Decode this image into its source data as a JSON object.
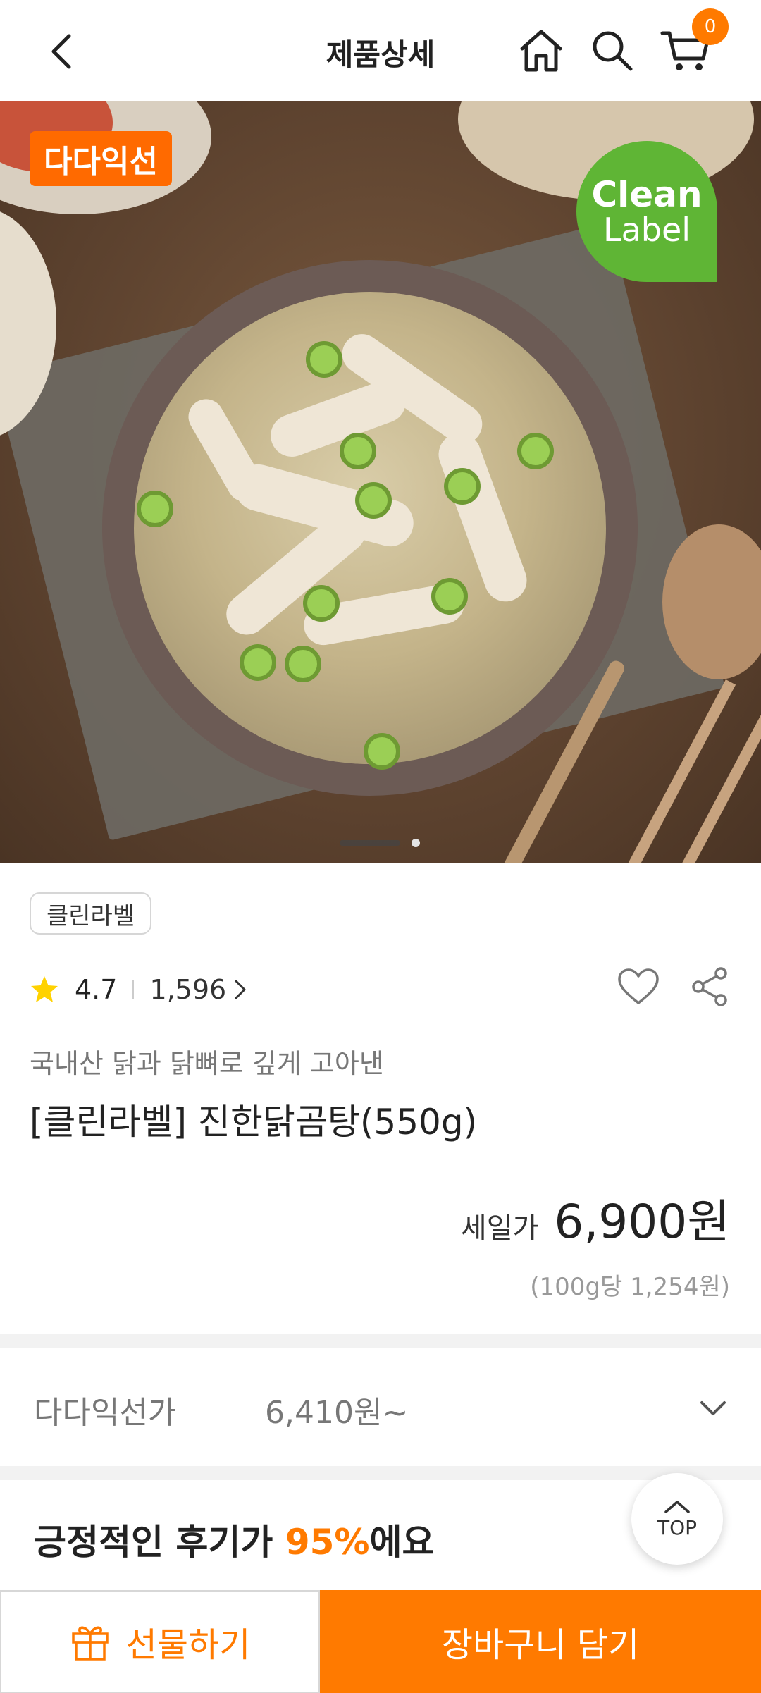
{
  "header": {
    "title": "제품상세",
    "cart_count": "0",
    "icons": [
      "back-arrow-icon",
      "home-icon",
      "search-icon",
      "cart-icon"
    ]
  },
  "hero": {
    "badge": "다다익선",
    "clean_label_line1": "Clean",
    "clean_label_line2": "Label",
    "pager": {
      "count": 2,
      "active": 1
    }
  },
  "product": {
    "tag": "클린라벨",
    "rating": "4.7",
    "review_count": "1,596",
    "subtitle": "국내산 닭과 닭뼈로 깊게 고아낸",
    "name": "[클린라벨] 진한닭곰탕(550g)",
    "price_label": "세일가",
    "price": "6,900원",
    "unit_price": "(100g당 1,254원)"
  },
  "member_price": {
    "label": "다다익선가",
    "value": "6,410원~"
  },
  "reviews": {
    "prefix": "긍정적인 후기가 ",
    "percent": "95%",
    "suffix": "에요"
  },
  "top_button": {
    "label": "TOP"
  },
  "bottom": {
    "gift_label": "선물하기",
    "cart_label": "장바구니 담기"
  },
  "colors": {
    "accent": "#ff7a00",
    "clean_label_green": "#5fb535",
    "star": "#ffd200"
  }
}
